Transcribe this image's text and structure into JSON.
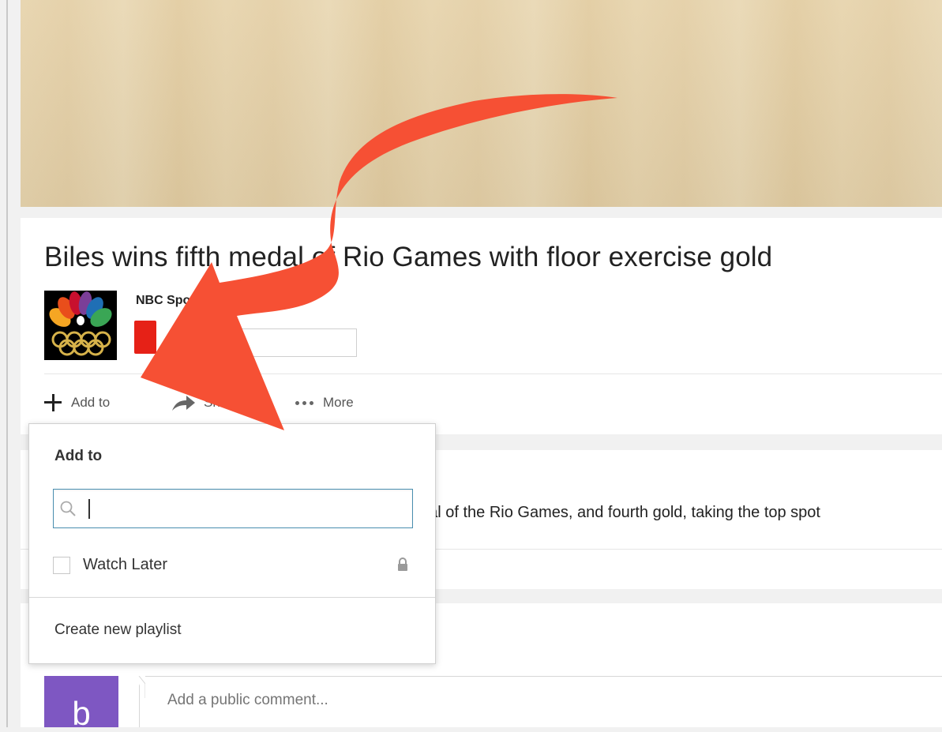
{
  "video": {
    "title": "Biles wins fifth medal of Rio Games with floor exercise gold"
  },
  "channel": {
    "name": "NBC Sports"
  },
  "actions": {
    "add_to_label": "Add to",
    "share_label": "Share",
    "more_label": "More"
  },
  "description": {
    "text": "dal of the Rio Games, and fourth gold, taking the top spot"
  },
  "comments": {
    "avatar_letter": "b",
    "placeholder": "Add a public comment..."
  },
  "add_to_popup": {
    "title": "Add to",
    "search_value": "",
    "playlists": [
      {
        "label": "Watch Later",
        "checked": false,
        "icon": "lock-icon"
      }
    ],
    "create_label": "Create new playlist"
  },
  "colors": {
    "annotation_arrow": "#f65034",
    "subscribe_red": "#e62117",
    "avatar_purple": "#7e57c2",
    "search_focus_border": "#4a8fb0"
  }
}
